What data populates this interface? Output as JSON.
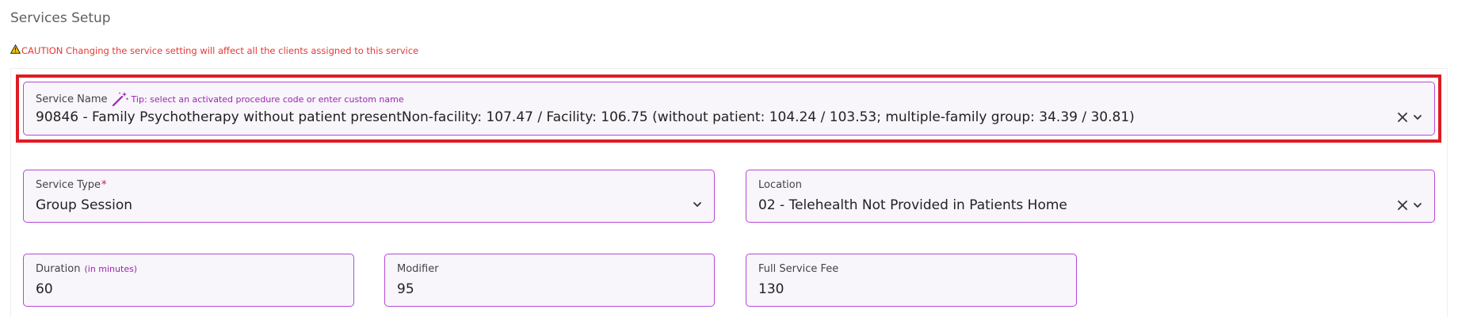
{
  "page": {
    "title": "Services Setup",
    "caution_text": "CAUTION Changing the service setting will affect all the clients assigned to this service"
  },
  "service_name": {
    "label": "Service Name",
    "tip": "Tip: select an activated procedure code or enter custom name",
    "value": "90846 - Family Psychotherapy without patient presentNon-facility: 107.47 / Facility: 106.75 (without patient: 104.24 / 103.53; multiple-family group: 34.39 / 30.81)"
  },
  "service_type": {
    "label": "Service Type",
    "required_mark": "*",
    "value": "Group Session"
  },
  "location": {
    "label": "Location",
    "value": "02 - Telehealth Not Provided in Patients Home"
  },
  "duration": {
    "label": "Duration",
    "hint": "(in minutes)",
    "value": "60"
  },
  "modifier": {
    "label": "Modifier",
    "value": "95"
  },
  "full_service_fee": {
    "label": "Full Service Fee",
    "value": "130"
  },
  "icons": {
    "warning": "warning-triangle-icon",
    "tip": "magic-wand-icon",
    "clear": "close-icon",
    "dropdown": "chevron-down-icon"
  },
  "colors": {
    "accent_purple": "#b44ad6",
    "field_background": "#f8f5fb",
    "caution_red": "#e53935",
    "highlight_red": "#e01b24",
    "warning_yellow": "#f5c400"
  }
}
